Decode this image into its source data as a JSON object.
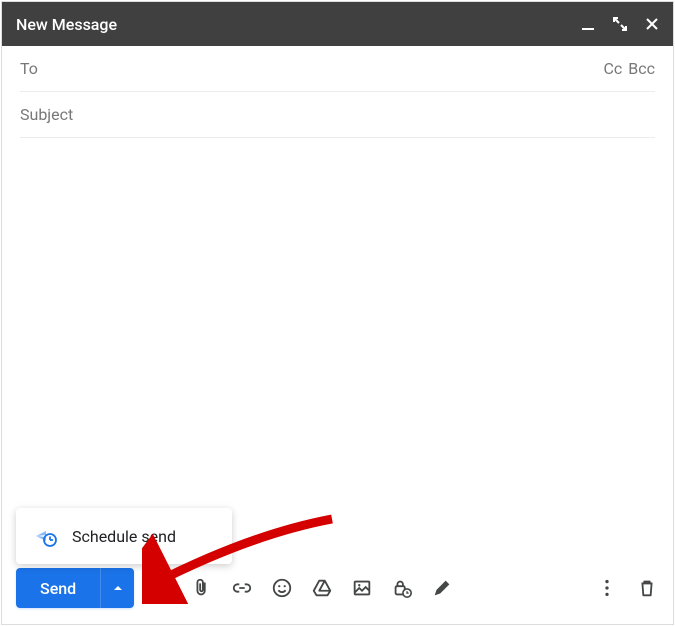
{
  "titlebar": {
    "title": "New Message"
  },
  "fields": {
    "to_label": "To",
    "cc_label": "Cc",
    "bcc_label": "Bcc",
    "subject_placeholder": "Subject"
  },
  "toolbar": {
    "send_label": "Send"
  },
  "menu": {
    "schedule_send_label": "Schedule send"
  }
}
